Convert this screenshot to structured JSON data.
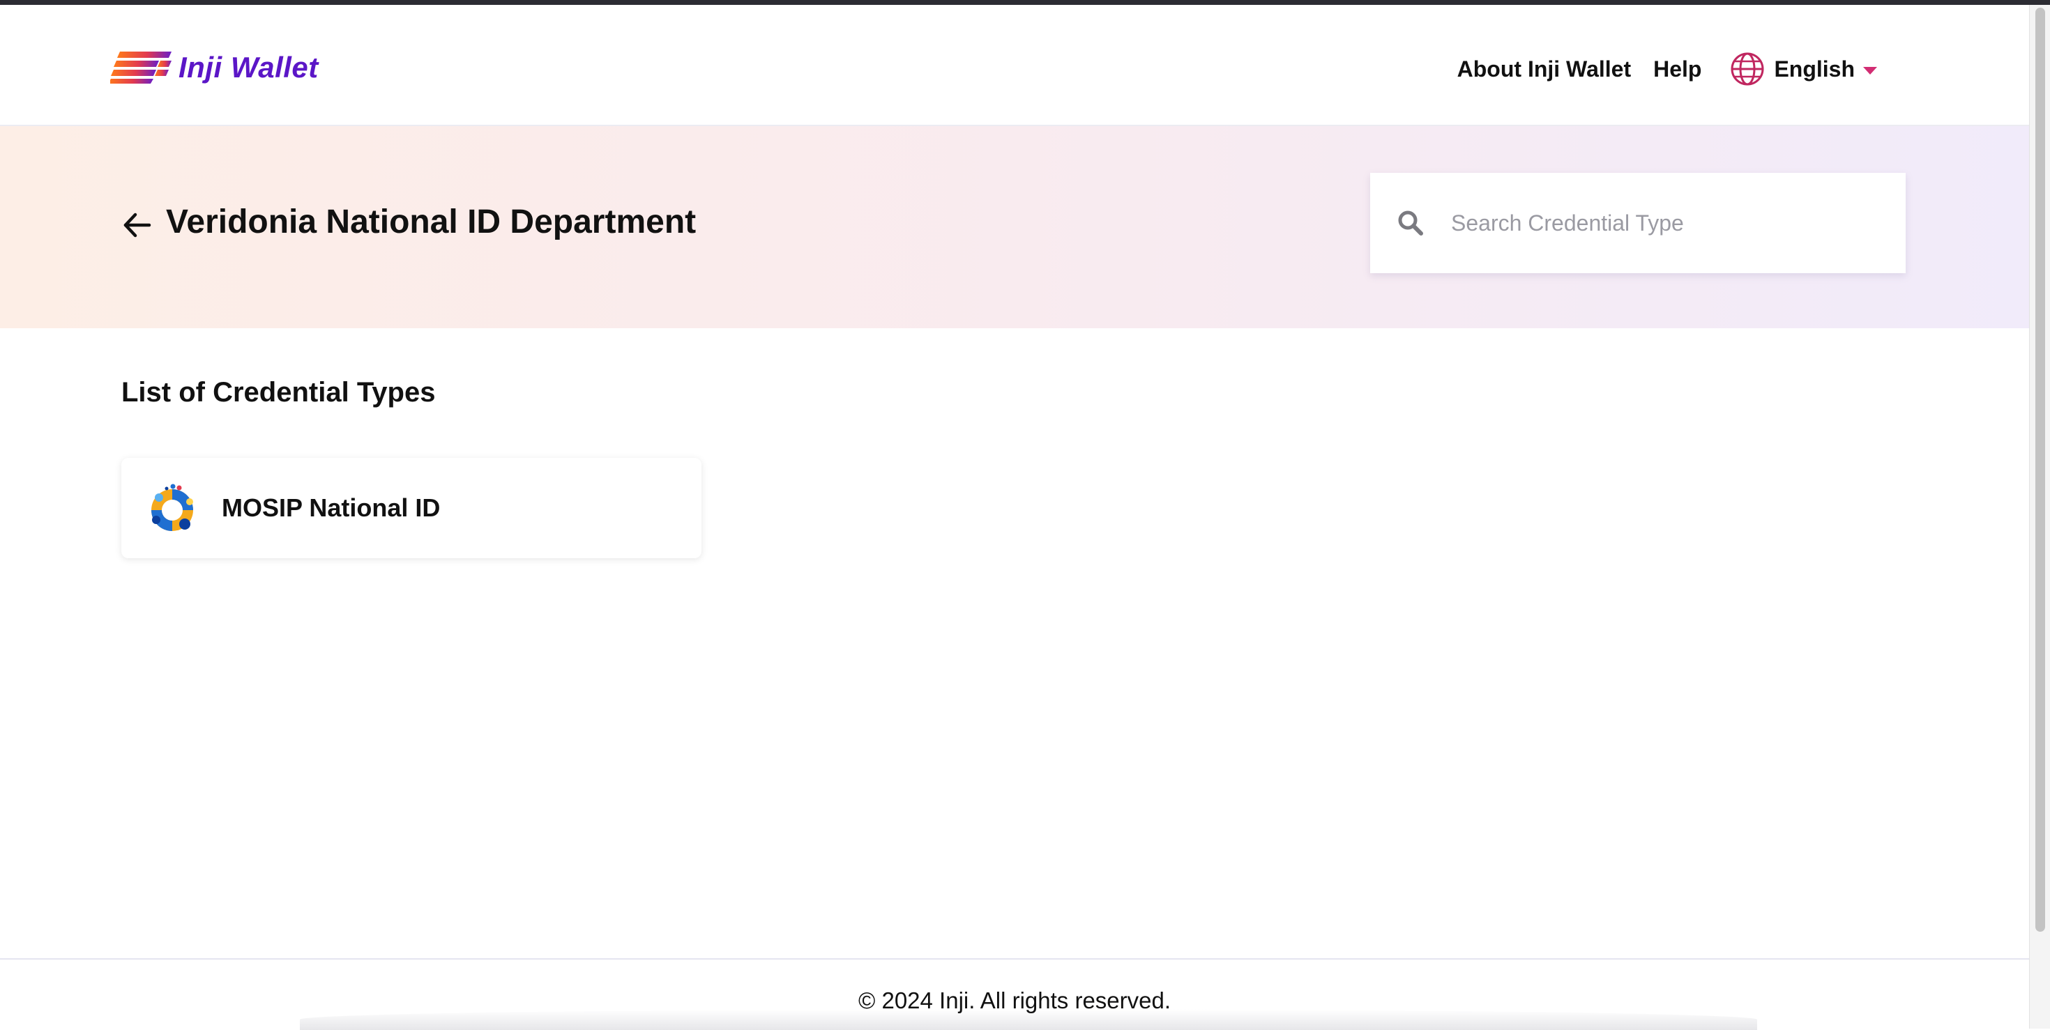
{
  "header": {
    "brand": "Inji Wallet",
    "nav": {
      "about": "About Inji Wallet",
      "help": "Help"
    },
    "language": {
      "selected": "English",
      "caret_color": "#d22d73"
    }
  },
  "banner": {
    "back_icon": "arrow-left-icon",
    "title": "Veridonia National ID Department",
    "search": {
      "placeholder": "Search Credential Type",
      "value": ""
    }
  },
  "main": {
    "section_title": "List of Credential Types",
    "credentials": [
      {
        "label": "MOSIP National ID",
        "icon": "mosip-logo-icon"
      }
    ]
  },
  "footer": {
    "text": "© 2024 Inji. All rights reserved."
  },
  "colors": {
    "brand": "#5b16c7",
    "accent": "#d22d73",
    "banner_start": "#fdeee6",
    "banner_end": "#f1ebfa"
  }
}
